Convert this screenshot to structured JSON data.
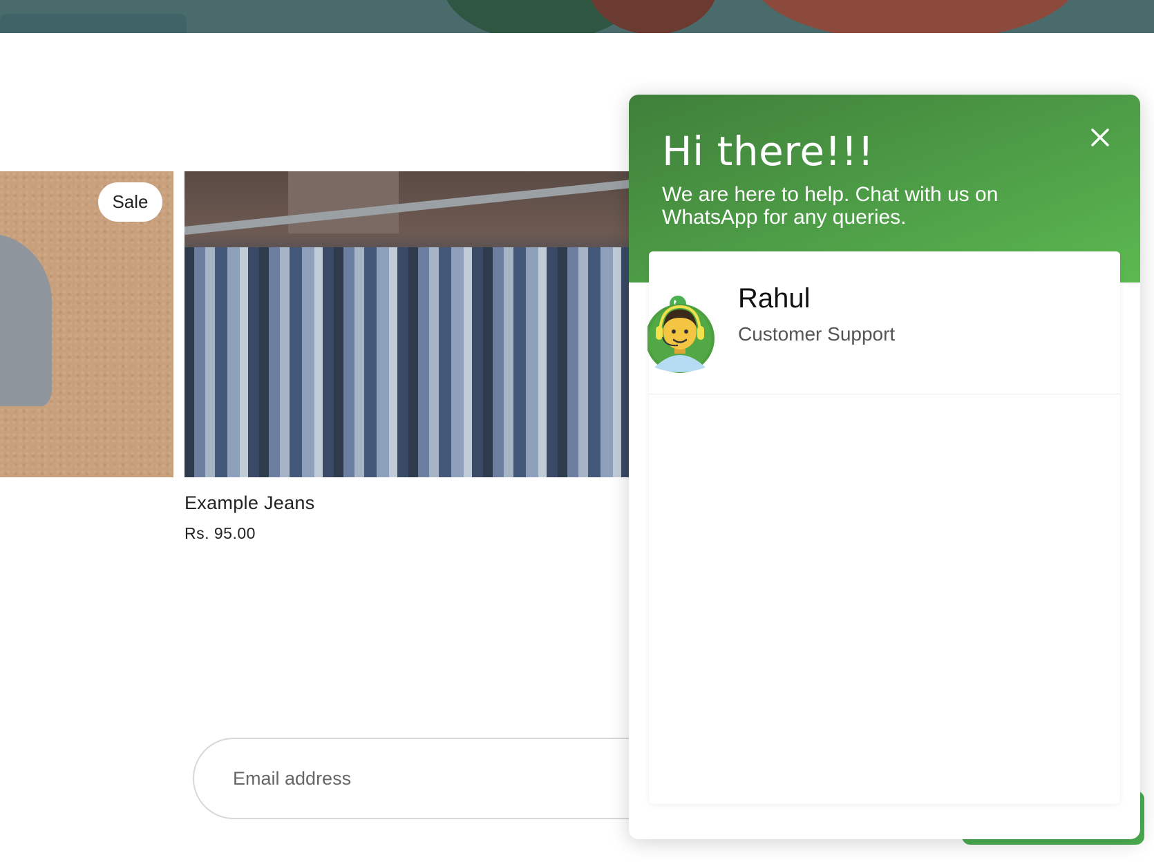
{
  "product": {
    "badge": "Sale",
    "title": "Example Jeans",
    "price": "Rs. 95.00"
  },
  "newsletter": {
    "email_placeholder": "Email address"
  },
  "chat": {
    "title": "Hi there!!!",
    "subtitle": "We are here to help. Chat with us on WhatsApp for any queries.",
    "agent": {
      "name": "Rahul",
      "role": "Customer Support"
    },
    "accent": "#4caf50"
  },
  "icons": [
    "close-icon",
    "whatsapp-icon",
    "agent-avatar"
  ]
}
